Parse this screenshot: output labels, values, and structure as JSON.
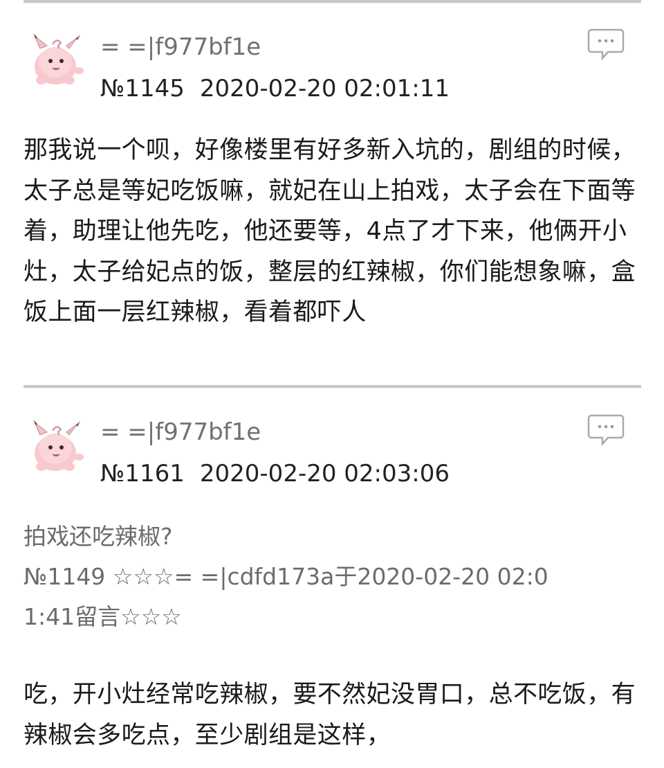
{
  "posts": [
    {
      "uid": "= =|f977bf1e",
      "number": "№1145",
      "datetime": "2020-02-20 02:01:11",
      "body": "那我说一个呗，好像楼里有好多新入坑的，剧组的时候，太子总是等妃吃饭嘛，就妃在山上拍戏，太子会在下面等着，助理让他先吃，他还要等，4点了才下来，他俩开小灶，太子给妃点的饭，整层的红辣椒，你们能想象嘛，盒饭上面一层红辣椒，看着都吓人"
    },
    {
      "uid": "= =|f977bf1e",
      "number": "№1161",
      "datetime": "2020-02-20 02:03:06",
      "quote": {
        "text": "拍戏还吃辣椒?",
        "ref_line1": "№1149 ☆☆☆= =|cdfd173a于2020-02-20 02:0",
        "ref_line2": "1:41留言☆☆☆"
      },
      "body": "吃，开小灶经常吃辣椒，要不然妃没胃口，总不吃饭，有辣椒会多吃点，至少剧组是这样，"
    }
  ],
  "icons": {
    "avatar": "clefairy-avatar-icon",
    "reply": "comment-bubble-icon"
  }
}
